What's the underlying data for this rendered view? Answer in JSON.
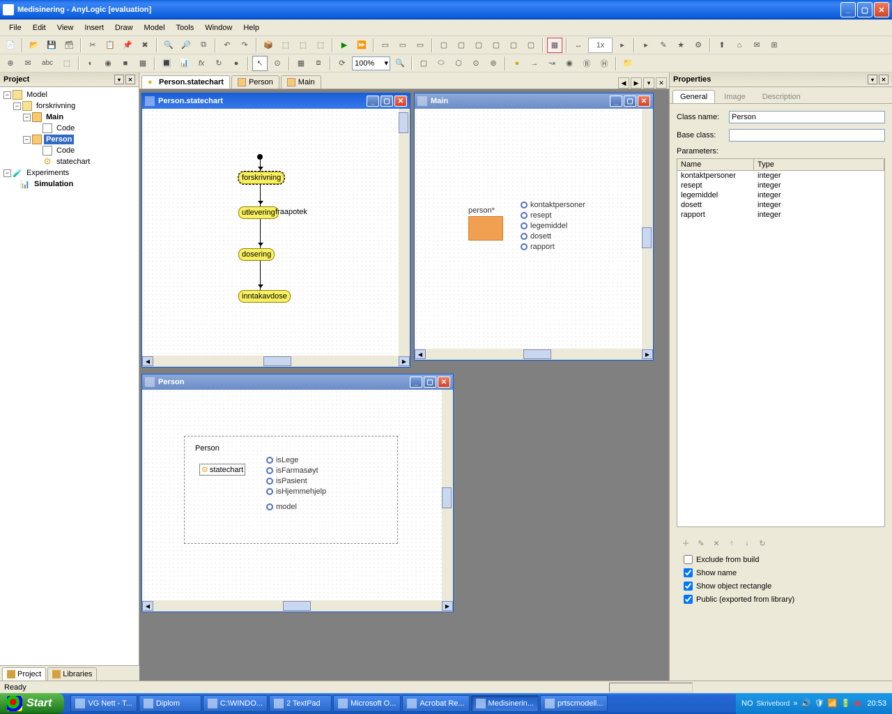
{
  "window": {
    "title": "Medisinering - AnyLogic [evaluation]"
  },
  "menu": [
    "File",
    "Edit",
    "View",
    "Insert",
    "Draw",
    "Model",
    "Tools",
    "Window",
    "Help"
  ],
  "zoom": "100%",
  "project_panel": {
    "title": "Project",
    "tree": {
      "model": "Model",
      "forskrivning": "forskrivning",
      "main": "Main",
      "main_code": "Code",
      "person": "Person",
      "person_code": "Code",
      "statechart": "statechart",
      "experiments": "Experiments",
      "simulation": "Simulation"
    },
    "tabs": {
      "project": "Project",
      "libraries": "Libraries"
    }
  },
  "editor_tabs": {
    "t1": "Person.statechart",
    "t2": "Person",
    "t3": "Main"
  },
  "mdi": {
    "statechart": {
      "title": "Person.statechart",
      "nodes": {
        "n1": "forskrivning",
        "n2": "utlevering",
        "n2b": "fraapotek",
        "n3": "dosering",
        "n4": "inntakavdose",
        "n4a": "inntakavdose"
      }
    },
    "main": {
      "title": "Main",
      "agent_label": "person*",
      "params": [
        "kontaktpersoner",
        "resept",
        "legemiddel",
        "dosett",
        "rapport"
      ]
    },
    "person": {
      "title": "Person",
      "classname": "Person",
      "statechart_lbl": "statechart",
      "params": [
        "isLege",
        "isFarmasøyt",
        "isPasient",
        "isHjemmehjelp",
        "model"
      ]
    }
  },
  "properties": {
    "title": "Properties",
    "tabs": {
      "general": "General",
      "image": "Image",
      "description": "Description"
    },
    "classname_lbl": "Class name:",
    "classname_val": "Person",
    "baseclass_lbl": "Base class:",
    "baseclass_val": "",
    "params_lbl": "Parameters:",
    "params_header": {
      "name": "Name",
      "type": "Type"
    },
    "params": [
      {
        "name": "kontaktpersoner",
        "type": "integer"
      },
      {
        "name": "resept",
        "type": "integer"
      },
      {
        "name": "legemiddel",
        "type": "integer"
      },
      {
        "name": "dosett",
        "type": "integer"
      },
      {
        "name": "rapport",
        "type": "integer"
      }
    ],
    "checks": {
      "exclude": "Exclude from build",
      "showname": "Show name",
      "showrect": "Show object rectangle",
      "public": "Public (exported from library)"
    }
  },
  "statusbar": {
    "ready": "Ready"
  },
  "taskbar": {
    "start": "Start",
    "items": [
      "VG Nett - T...",
      "Diplom",
      "C:\\WINDO...",
      "2 TextPad",
      "Microsoft O...",
      "Acrobat Re...",
      "Medisinerin...",
      "prtscmodell..."
    ],
    "tray": {
      "lang": "NO",
      "label": "Skrivebord",
      "time": "20:53"
    }
  }
}
